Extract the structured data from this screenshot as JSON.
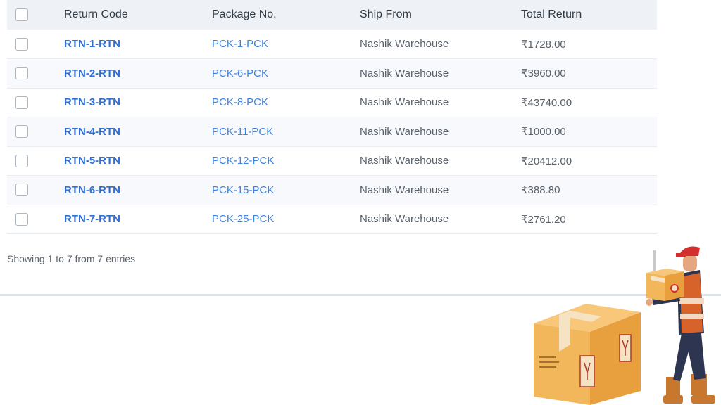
{
  "table": {
    "headers": {
      "return_code": "Return Code",
      "package_no": "Package No.",
      "ship_from": "Ship From",
      "total_return": "Total Return"
    },
    "rows": [
      {
        "return_code": "RTN-1-RTN",
        "package_no": "PCK-1-PCK",
        "ship_from": "Nashik Warehouse",
        "total_return": "₹1728.00"
      },
      {
        "return_code": "RTN-2-RTN",
        "package_no": "PCK-6-PCK",
        "ship_from": "Nashik Warehouse",
        "total_return": "₹3960.00"
      },
      {
        "return_code": "RTN-3-RTN",
        "package_no": "PCK-8-PCK",
        "ship_from": "Nashik Warehouse",
        "total_return": "₹43740.00"
      },
      {
        "return_code": "RTN-4-RTN",
        "package_no": "PCK-11-PCK",
        "ship_from": "Nashik Warehouse",
        "total_return": "₹1000.00"
      },
      {
        "return_code": "RTN-5-RTN",
        "package_no": "PCK-12-PCK",
        "ship_from": "Nashik Warehouse",
        "total_return": "₹20412.00"
      },
      {
        "return_code": "RTN-6-RTN",
        "package_no": "PCK-15-PCK",
        "ship_from": "Nashik Warehouse",
        "total_return": "₹388.80"
      },
      {
        "return_code": "RTN-7-RTN",
        "package_no": "PCK-25-PCK",
        "ship_from": "Nashik Warehouse",
        "total_return": "₹2761.20"
      }
    ]
  },
  "footer": {
    "entries_text": "Showing 1 to 7 from 7 entries"
  },
  "illustration": {
    "icon": "delivery-worker-with-boxes-illustration"
  },
  "colors": {
    "link": "#2f6fd6",
    "header_bg": "#eef1f5",
    "box": "#f2b75b"
  }
}
